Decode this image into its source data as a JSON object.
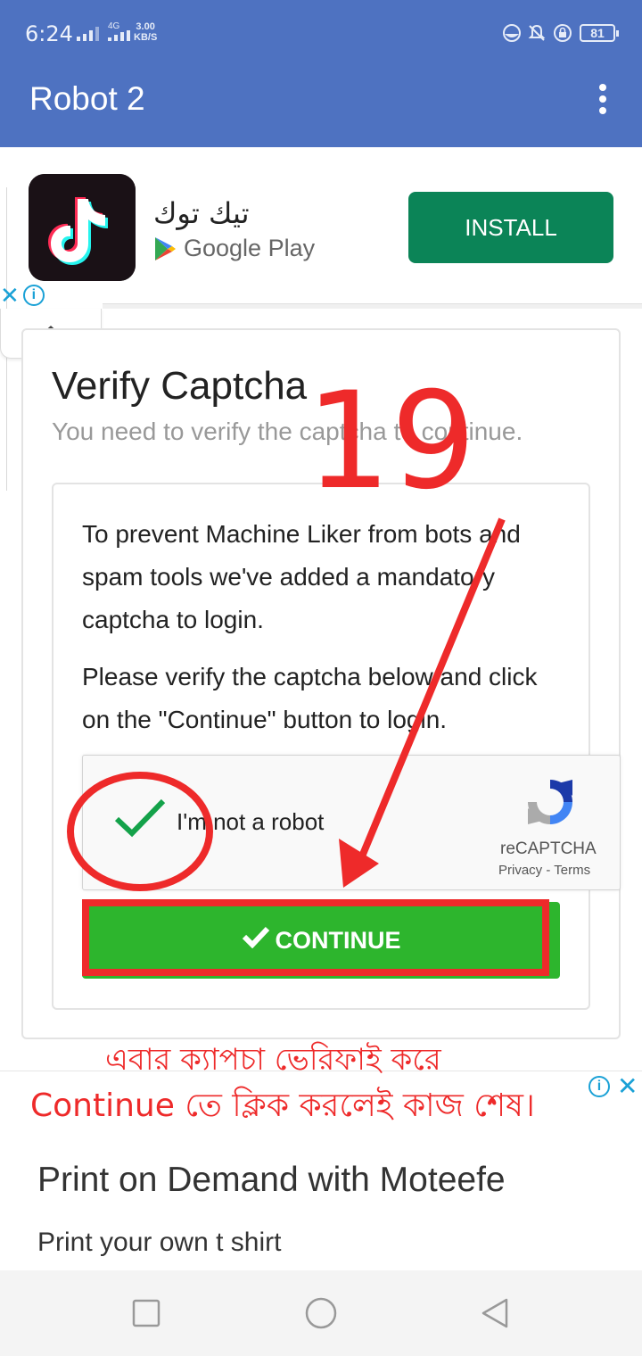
{
  "status_bar": {
    "time": "6:24",
    "network": "4G",
    "speed_value": "3.00",
    "speed_unit": "KB/S",
    "battery": "81"
  },
  "app_bar": {
    "title": "Robot 2",
    "menu_icon": "more-vert-icon"
  },
  "top_ad": {
    "app_name": "تيك توك",
    "store": "Google Play",
    "install_label": "INSTALL"
  },
  "captcha_card": {
    "title": "Verify Captcha",
    "subtitle": "You need to verify the captcha to continue.",
    "paragraph1": "To prevent Machine Liker from bots and spam tools we've added a mandatory captcha to login.",
    "paragraph2": "Please verify the captcha below and click on the \"Continue\" button to login.",
    "recaptcha": {
      "label": "I'm not a robot",
      "brand": "reCAPTCHA",
      "privacy": "Privacy",
      "separator": " - ",
      "terms": "Terms",
      "checked": true
    },
    "continue_label": "CONTINUE"
  },
  "annotations": {
    "step_number": "19",
    "bengali_line1": "এবার ক্যাপচা ভেরিফাই করে",
    "bengali_line2": "Continue তে ক্লিক করলেই কাজ শেষ।",
    "color": "#ee2a2a"
  },
  "bottom_ad": {
    "title": "Print on Demand with Moteefe",
    "description": "Print your own t shirt"
  },
  "colors": {
    "app_bar": "#4e72c1",
    "install": "#0b8457",
    "continue": "#2db52d",
    "annotation": "#ee2a2a"
  }
}
